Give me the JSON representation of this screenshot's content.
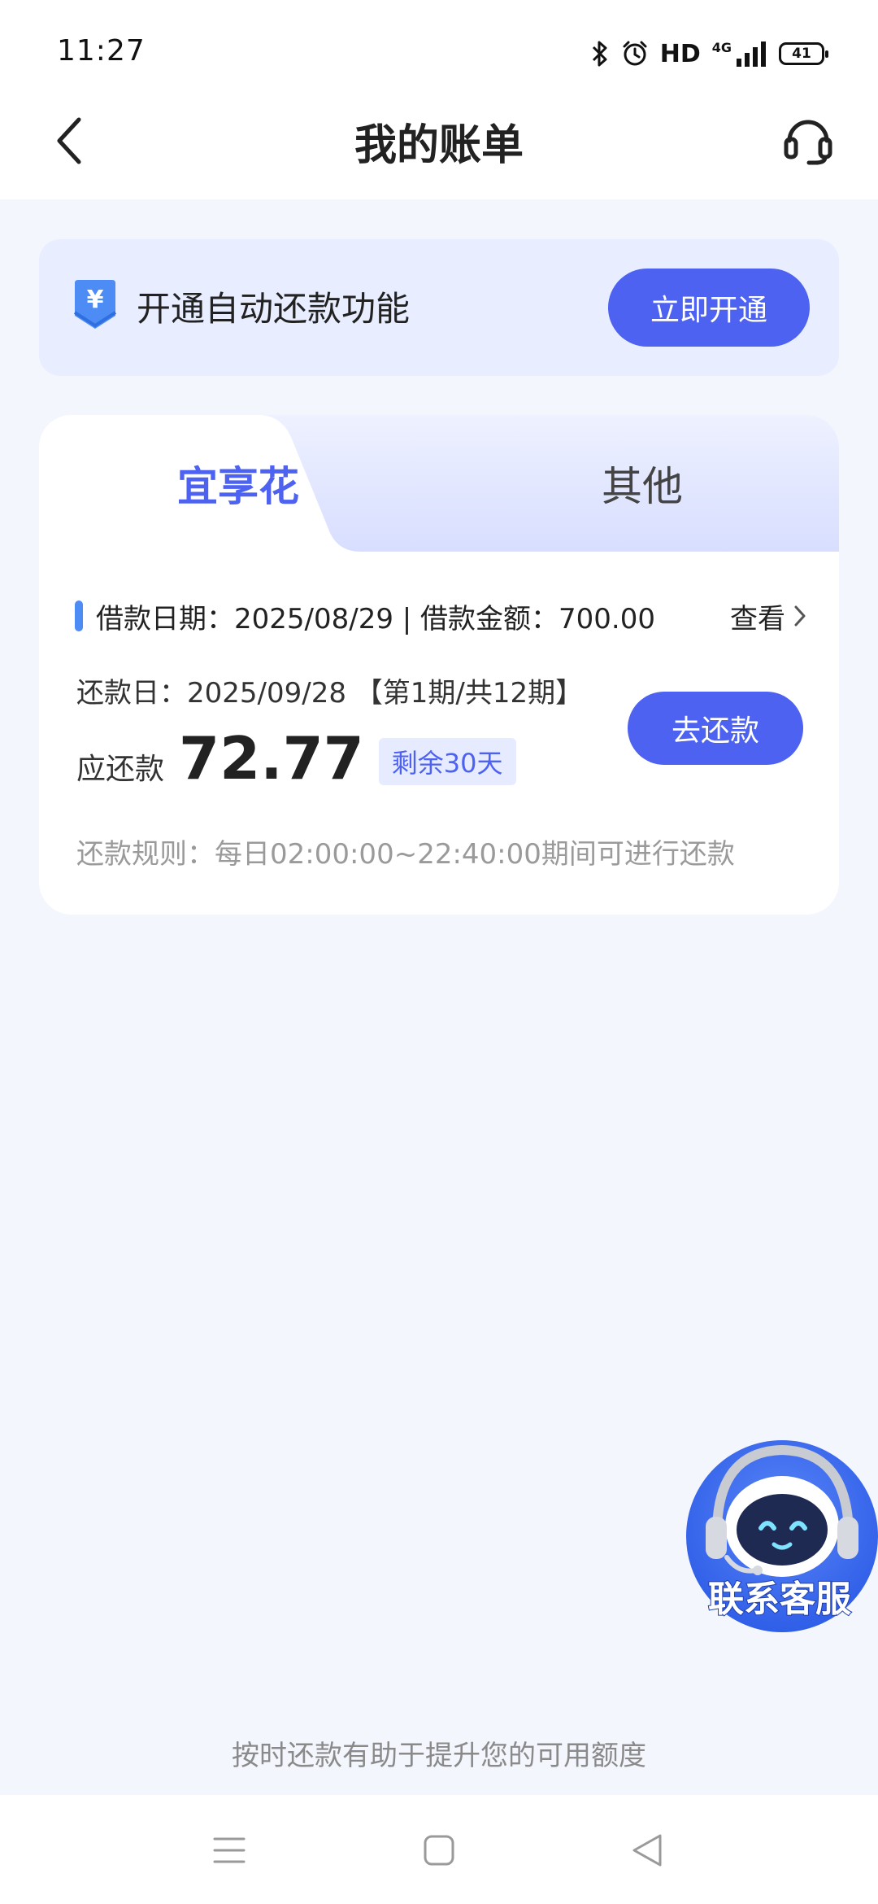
{
  "status_bar": {
    "time": "11:27",
    "hd": "HD",
    "network": "4G",
    "battery": "41",
    "icons": [
      "bluetooth-icon",
      "alarm-icon",
      "signal-icon",
      "battery-icon"
    ]
  },
  "header": {
    "title": "我的账单",
    "back_icon": "chevron-left-icon",
    "service_icon": "headset-icon"
  },
  "autopay": {
    "icon": "yuan-download-icon",
    "text": "开通自动还款功能",
    "button": "立即开通"
  },
  "tabs": [
    {
      "label": "宜享花",
      "active": true
    },
    {
      "label": "其他",
      "active": false
    }
  ],
  "bill": {
    "loan_info": "借款日期：2025/08/29 | 借款金额：700.00",
    "view_label": "查看",
    "repay_date": "还款日：2025/09/28 【第1期/共12期】",
    "due_label": "应还款",
    "due_amount": "72.77",
    "days_left": "剩余30天",
    "repay_button": "去还款",
    "rule": "还款规则：每日02:00:00~22:40:00期间可进行还款"
  },
  "float_contact": {
    "label": "联系客服",
    "icon": "robot-headset-icon"
  },
  "footer_tip": "按时还款有助于提升您的可用额度",
  "colors": {
    "primary": "#4d62f0",
    "background": "#f4f6fd",
    "banner_bg": "#e8eeff",
    "accent_mark": "#4d8cf5"
  }
}
